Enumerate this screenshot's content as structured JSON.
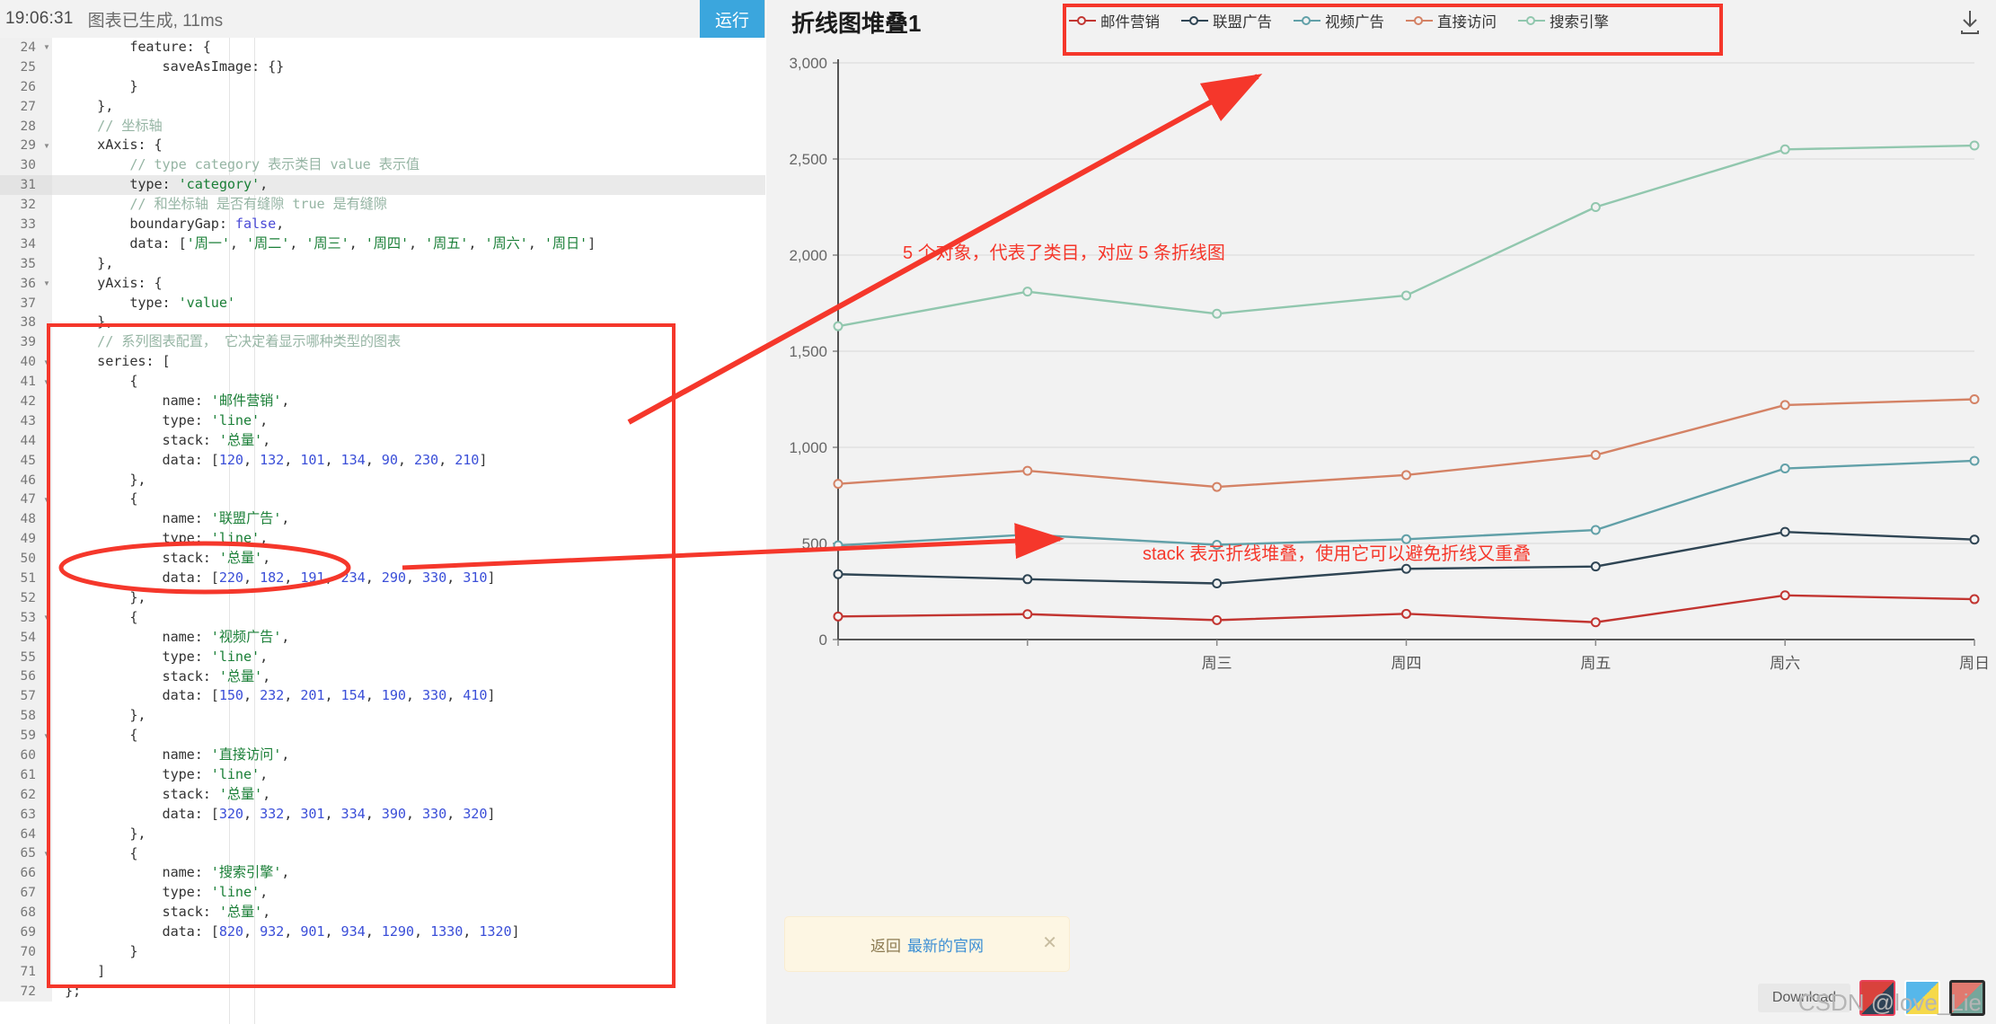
{
  "editor": {
    "status_time": "19:06:31",
    "status_message": "图表已生成, 11ms",
    "run_label": "运行",
    "lines": [
      {
        "n": "24",
        "fold": true,
        "hl": false,
        "text": "        feature: {"
      },
      {
        "n": "25",
        "fold": false,
        "hl": false,
        "text": "            saveAsImage: {}"
      },
      {
        "n": "26",
        "fold": false,
        "hl": false,
        "text": "        }"
      },
      {
        "n": "27",
        "fold": false,
        "hl": false,
        "text": "    },"
      },
      {
        "n": "28",
        "fold": false,
        "hl": false,
        "text": "    // 坐标轴"
      },
      {
        "n": "29",
        "fold": true,
        "hl": false,
        "text": "    xAxis: {"
      },
      {
        "n": "30",
        "fold": false,
        "hl": false,
        "text": "        // type category 表示类目 value 表示值"
      },
      {
        "n": "31",
        "fold": false,
        "hl": true,
        "text": "        type: 'category',"
      },
      {
        "n": "32",
        "fold": false,
        "hl": false,
        "text": "        // 和坐标轴 是否有缝隙 true 是有缝隙"
      },
      {
        "n": "33",
        "fold": false,
        "hl": false,
        "text": "        boundaryGap: false,"
      },
      {
        "n": "34",
        "fold": false,
        "hl": false,
        "text": "        data: ['周一', '周二', '周三', '周四', '周五', '周六', '周日']"
      },
      {
        "n": "35",
        "fold": false,
        "hl": false,
        "text": "    },"
      },
      {
        "n": "36",
        "fold": true,
        "hl": false,
        "text": "    yAxis: {"
      },
      {
        "n": "37",
        "fold": false,
        "hl": false,
        "text": "        type: 'value'"
      },
      {
        "n": "38",
        "fold": false,
        "hl": false,
        "text": "    },"
      },
      {
        "n": "39",
        "fold": false,
        "hl": false,
        "text": "    // 系列图表配置， 它决定着显示哪种类型的图表"
      },
      {
        "n": "40",
        "fold": true,
        "hl": false,
        "text": "    series: ["
      },
      {
        "n": "41",
        "fold": true,
        "hl": false,
        "text": "        {"
      },
      {
        "n": "42",
        "fold": false,
        "hl": false,
        "text": "            name: '邮件营销',"
      },
      {
        "n": "43",
        "fold": false,
        "hl": false,
        "text": "            type: 'line',"
      },
      {
        "n": "44",
        "fold": false,
        "hl": false,
        "text": "            stack: '总量',"
      },
      {
        "n": "45",
        "fold": false,
        "hl": false,
        "text": "            data: [120, 132, 101, 134, 90, 230, 210]"
      },
      {
        "n": "46",
        "fold": false,
        "hl": false,
        "text": "        },"
      },
      {
        "n": "47",
        "fold": true,
        "hl": false,
        "text": "        {"
      },
      {
        "n": "48",
        "fold": false,
        "hl": false,
        "text": "            name: '联盟广告',"
      },
      {
        "n": "49",
        "fold": false,
        "hl": false,
        "text": "            type: 'line',"
      },
      {
        "n": "50",
        "fold": false,
        "hl": false,
        "text": "            stack: '总量',"
      },
      {
        "n": "51",
        "fold": false,
        "hl": false,
        "text": "            data: [220, 182, 191, 234, 290, 330, 310]"
      },
      {
        "n": "52",
        "fold": false,
        "hl": false,
        "text": "        },"
      },
      {
        "n": "53",
        "fold": true,
        "hl": false,
        "text": "        {"
      },
      {
        "n": "54",
        "fold": false,
        "hl": false,
        "text": "            name: '视频广告',"
      },
      {
        "n": "55",
        "fold": false,
        "hl": false,
        "text": "            type: 'line',"
      },
      {
        "n": "56",
        "fold": false,
        "hl": false,
        "text": "            stack: '总量',"
      },
      {
        "n": "57",
        "fold": false,
        "hl": false,
        "text": "            data: [150, 232, 201, 154, 190, 330, 410]"
      },
      {
        "n": "58",
        "fold": false,
        "hl": false,
        "text": "        },"
      },
      {
        "n": "59",
        "fold": true,
        "hl": false,
        "text": "        {"
      },
      {
        "n": "60",
        "fold": false,
        "hl": false,
        "text": "            name: '直接访问',"
      },
      {
        "n": "61",
        "fold": false,
        "hl": false,
        "text": "            type: 'line',"
      },
      {
        "n": "62",
        "fold": false,
        "hl": false,
        "text": "            stack: '总量',"
      },
      {
        "n": "63",
        "fold": false,
        "hl": false,
        "text": "            data: [320, 332, 301, 334, 390, 330, 320]"
      },
      {
        "n": "64",
        "fold": false,
        "hl": false,
        "text": "        },"
      },
      {
        "n": "65",
        "fold": true,
        "hl": false,
        "text": "        {"
      },
      {
        "n": "66",
        "fold": false,
        "hl": false,
        "text": "            name: '搜索引擎',"
      },
      {
        "n": "67",
        "fold": false,
        "hl": false,
        "text": "            type: 'line',"
      },
      {
        "n": "68",
        "fold": false,
        "hl": false,
        "text": "            stack: '总量',"
      },
      {
        "n": "69",
        "fold": false,
        "hl": false,
        "text": "            data: [820, 932, 901, 934, 1290, 1330, 1320]"
      },
      {
        "n": "70",
        "fold": false,
        "hl": false,
        "text": "        }"
      },
      {
        "n": "71",
        "fold": false,
        "hl": false,
        "text": "    ]"
      },
      {
        "n": "72",
        "fold": false,
        "hl": false,
        "text": "};"
      }
    ]
  },
  "chart_panel": {
    "title": "折线图堆叠1",
    "download_icon": "download-icon",
    "toast": {
      "back_label": "返回",
      "link_label": "最新的官网",
      "close_icon": "close-icon"
    },
    "bottom": {
      "download_label": "Download",
      "watermark": "CSDN @love_Lie"
    }
  },
  "annotations": {
    "text_categories": "5 个对象，代表了类目，对应 5 条折线图",
    "text_stack": "stack 表示折线堆叠，使用它可以避免折线又重叠",
    "color": "#f5372b"
  },
  "chart_data": {
    "type": "line",
    "title": "折线图堆叠1",
    "stacked": true,
    "stack_name": "总量",
    "xlabel": "",
    "ylabel": "",
    "categories": [
      "周一",
      "周二",
      "周三",
      "周四",
      "周五",
      "周六",
      "周日"
    ],
    "visible_tick_labels": [
      "周三",
      "周四",
      "周五",
      "周六",
      "周日"
    ],
    "ylim": [
      0,
      3000
    ],
    "yticks": [
      0,
      500,
      1000,
      1500,
      2000,
      2500,
      3000
    ],
    "ytick_labels": [
      "0",
      "500",
      "1,000",
      "1,500",
      "2,000",
      "2,500",
      "3,000"
    ],
    "grid": true,
    "legend_position": "top",
    "boundary_gap": false,
    "series": [
      {
        "name": "邮件营销",
        "color": "#c23531",
        "values": [
          120,
          132,
          101,
          134,
          90,
          230,
          210
        ],
        "cumulative": [
          120,
          132,
          101,
          134,
          90,
          230,
          210
        ]
      },
      {
        "name": "联盟广告",
        "color": "#2f4554",
        "values": [
          220,
          182,
          191,
          234,
          290,
          330,
          310
        ],
        "cumulative": [
          340,
          314,
          292,
          368,
          380,
          560,
          520
        ]
      },
      {
        "name": "视频广告",
        "color": "#61a0a8",
        "values": [
          150,
          232,
          201,
          154,
          190,
          330,
          410
        ],
        "cumulative": [
          490,
          546,
          493,
          522,
          570,
          890,
          930
        ]
      },
      {
        "name": "直接访问",
        "color": "#d48265",
        "values": [
          320,
          332,
          301,
          334,
          390,
          330,
          320
        ],
        "cumulative": [
          810,
          878,
          794,
          856,
          960,
          1220,
          1250
        ]
      },
      {
        "name": "搜索引擎",
        "color": "#91c7ae",
        "values": [
          820,
          932,
          901,
          934,
          1290,
          1330,
          1320
        ],
        "cumulative": [
          1630,
          1810,
          1695,
          1790,
          2250,
          2550,
          2570
        ]
      }
    ]
  }
}
